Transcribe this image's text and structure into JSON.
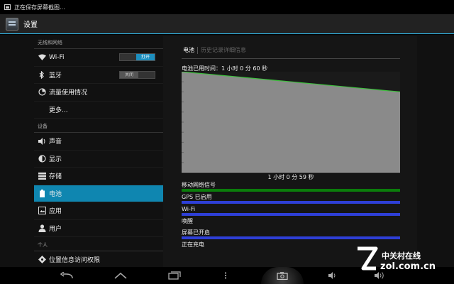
{
  "status_bar": {
    "notification_text": "正在保存屏幕截图..."
  },
  "action_bar": {
    "title": "设置"
  },
  "sidebar": {
    "sections": [
      {
        "header": "无线和网络",
        "items": [
          {
            "label": "Wi-Fi",
            "icon": "wifi-icon",
            "toggle": "打开"
          },
          {
            "label": "蓝牙",
            "icon": "bluetooth-icon",
            "toggle": "关闭"
          },
          {
            "label": "流量使用情况",
            "icon": "data-usage-icon"
          },
          {
            "label": "更多...",
            "icon": ""
          }
        ]
      },
      {
        "header": "设备",
        "items": [
          {
            "label": "声音",
            "icon": "sound-icon"
          },
          {
            "label": "显示",
            "icon": "display-icon"
          },
          {
            "label": "存储",
            "icon": "storage-icon"
          },
          {
            "label": "电池",
            "icon": "battery-icon"
          },
          {
            "label": "应用",
            "icon": "apps-icon"
          },
          {
            "label": "用户",
            "icon": "user-icon"
          }
        ]
      },
      {
        "header": "个人",
        "items": [
          {
            "label": "位置信息访问权限",
            "icon": "location-icon"
          }
        ]
      }
    ]
  },
  "detail": {
    "tab_active": "电池",
    "tab_inactive": "历史记录详细信息",
    "usage_time": "电池已用时间：1 小时 0 分 60 秒",
    "duration_label": "1 小时 0 分 59 秒",
    "signals": [
      {
        "label": "移动网络信号",
        "color": "#0b7d0b"
      },
      {
        "label": "GPS 已启用",
        "color": "#2e3fd6"
      },
      {
        "label": "Wi-Fi",
        "color": "#2e3fd6"
      },
      {
        "label": "唤醒",
        "color": ""
      },
      {
        "label": "屏幕已开启",
        "color": "#2e3fd6"
      },
      {
        "label": "正在充电",
        "color": ""
      }
    ]
  },
  "chart_data": {
    "type": "area",
    "x": [
      0,
      1
    ],
    "values": [
      100,
      80
    ],
    "ylim": [
      0,
      100
    ],
    "line_color": "#3fbf3f",
    "fill_color": "#8a8a8a"
  },
  "nav_bar": {
    "buttons": [
      "back-icon",
      "home-icon",
      "recent-apps-icon",
      "menu-icon",
      "screenshot-icon",
      "volume-down-icon",
      "volume-up-icon"
    ]
  },
  "watermark": {
    "brand_cn": "中关村在线",
    "brand_en": "zol.com.cn"
  }
}
